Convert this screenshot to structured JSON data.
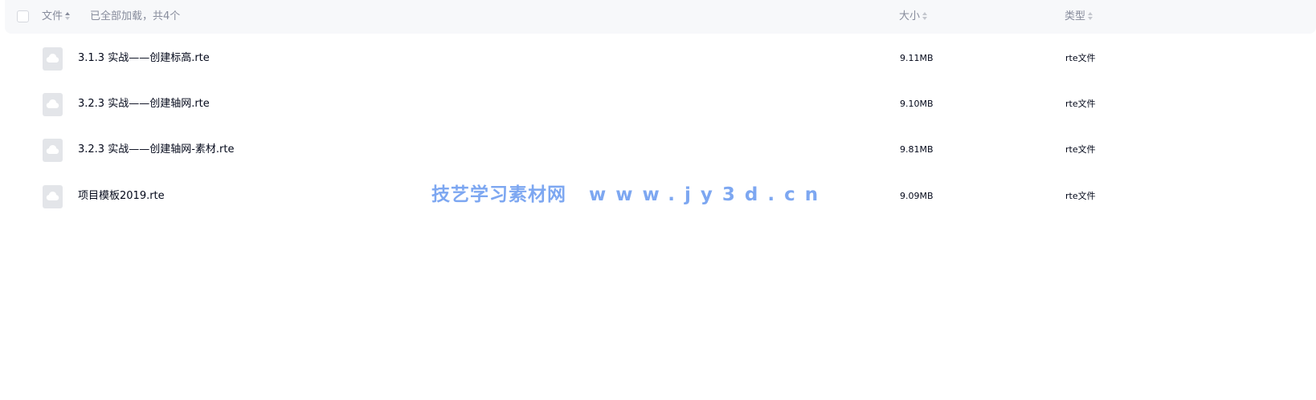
{
  "header": {
    "col_name": "文件",
    "loaded_note": "已全部加载，共4个",
    "col_size": "大小",
    "col_type": "类型"
  },
  "files": [
    {
      "name": "3.1.3 实战——创建标高.rte",
      "size": "9.11MB",
      "type": "rte文件",
      "icon": "cloud-file-icon"
    },
    {
      "name": "3.2.3 实战——创建轴网.rte",
      "size": "9.10MB",
      "type": "rte文件",
      "icon": "cloud-file-icon"
    },
    {
      "name": "3.2.3 实战——创建轴网-素材.rte",
      "size": "9.81MB",
      "type": "rte文件",
      "icon": "cloud-file-icon"
    },
    {
      "name": "项目模板2019.rte",
      "size": "9.09MB",
      "type": "rte文件",
      "icon": "cloud-file-icon"
    }
  ],
  "watermark": {
    "site_name": "技艺学习素材网",
    "url": "www.jy3d.cn"
  },
  "colors": {
    "header_bg": "#f7f8fa",
    "header_text": "#878c9c",
    "body_text": "#03081a",
    "icon_bg": "#e3e5e9",
    "watermark": "#6f9ef0"
  }
}
